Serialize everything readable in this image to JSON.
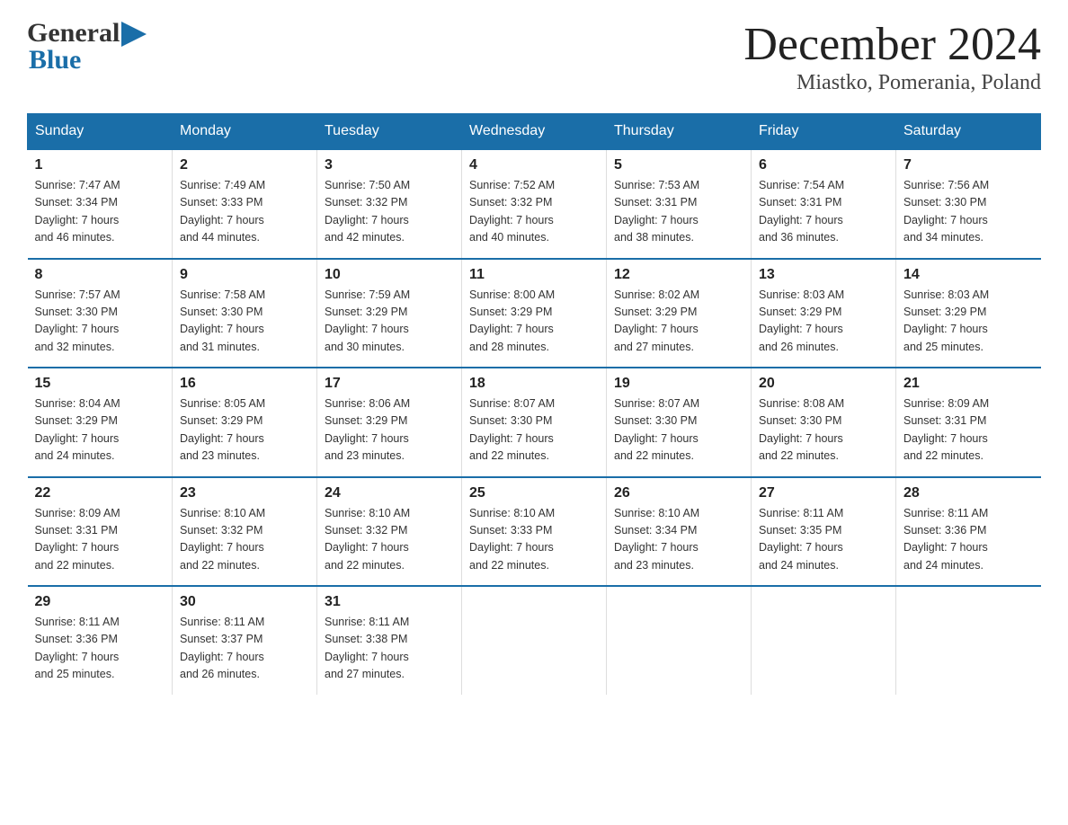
{
  "header": {
    "logo_general": "General",
    "logo_blue": "Blue",
    "month_title": "December 2024",
    "location": "Miastko, Pomerania, Poland"
  },
  "weekdays": [
    "Sunday",
    "Monday",
    "Tuesday",
    "Wednesday",
    "Thursday",
    "Friday",
    "Saturday"
  ],
  "weeks": [
    [
      {
        "day": "1",
        "info": "Sunrise: 7:47 AM\nSunset: 3:34 PM\nDaylight: 7 hours\nand 46 minutes."
      },
      {
        "day": "2",
        "info": "Sunrise: 7:49 AM\nSunset: 3:33 PM\nDaylight: 7 hours\nand 44 minutes."
      },
      {
        "day": "3",
        "info": "Sunrise: 7:50 AM\nSunset: 3:32 PM\nDaylight: 7 hours\nand 42 minutes."
      },
      {
        "day": "4",
        "info": "Sunrise: 7:52 AM\nSunset: 3:32 PM\nDaylight: 7 hours\nand 40 minutes."
      },
      {
        "day": "5",
        "info": "Sunrise: 7:53 AM\nSunset: 3:31 PM\nDaylight: 7 hours\nand 38 minutes."
      },
      {
        "day": "6",
        "info": "Sunrise: 7:54 AM\nSunset: 3:31 PM\nDaylight: 7 hours\nand 36 minutes."
      },
      {
        "day": "7",
        "info": "Sunrise: 7:56 AM\nSunset: 3:30 PM\nDaylight: 7 hours\nand 34 minutes."
      }
    ],
    [
      {
        "day": "8",
        "info": "Sunrise: 7:57 AM\nSunset: 3:30 PM\nDaylight: 7 hours\nand 32 minutes."
      },
      {
        "day": "9",
        "info": "Sunrise: 7:58 AM\nSunset: 3:30 PM\nDaylight: 7 hours\nand 31 minutes."
      },
      {
        "day": "10",
        "info": "Sunrise: 7:59 AM\nSunset: 3:29 PM\nDaylight: 7 hours\nand 30 minutes."
      },
      {
        "day": "11",
        "info": "Sunrise: 8:00 AM\nSunset: 3:29 PM\nDaylight: 7 hours\nand 28 minutes."
      },
      {
        "day": "12",
        "info": "Sunrise: 8:02 AM\nSunset: 3:29 PM\nDaylight: 7 hours\nand 27 minutes."
      },
      {
        "day": "13",
        "info": "Sunrise: 8:03 AM\nSunset: 3:29 PM\nDaylight: 7 hours\nand 26 minutes."
      },
      {
        "day": "14",
        "info": "Sunrise: 8:03 AM\nSunset: 3:29 PM\nDaylight: 7 hours\nand 25 minutes."
      }
    ],
    [
      {
        "day": "15",
        "info": "Sunrise: 8:04 AM\nSunset: 3:29 PM\nDaylight: 7 hours\nand 24 minutes."
      },
      {
        "day": "16",
        "info": "Sunrise: 8:05 AM\nSunset: 3:29 PM\nDaylight: 7 hours\nand 23 minutes."
      },
      {
        "day": "17",
        "info": "Sunrise: 8:06 AM\nSunset: 3:29 PM\nDaylight: 7 hours\nand 23 minutes."
      },
      {
        "day": "18",
        "info": "Sunrise: 8:07 AM\nSunset: 3:30 PM\nDaylight: 7 hours\nand 22 minutes."
      },
      {
        "day": "19",
        "info": "Sunrise: 8:07 AM\nSunset: 3:30 PM\nDaylight: 7 hours\nand 22 minutes."
      },
      {
        "day": "20",
        "info": "Sunrise: 8:08 AM\nSunset: 3:30 PM\nDaylight: 7 hours\nand 22 minutes."
      },
      {
        "day": "21",
        "info": "Sunrise: 8:09 AM\nSunset: 3:31 PM\nDaylight: 7 hours\nand 22 minutes."
      }
    ],
    [
      {
        "day": "22",
        "info": "Sunrise: 8:09 AM\nSunset: 3:31 PM\nDaylight: 7 hours\nand 22 minutes."
      },
      {
        "day": "23",
        "info": "Sunrise: 8:10 AM\nSunset: 3:32 PM\nDaylight: 7 hours\nand 22 minutes."
      },
      {
        "day": "24",
        "info": "Sunrise: 8:10 AM\nSunset: 3:32 PM\nDaylight: 7 hours\nand 22 minutes."
      },
      {
        "day": "25",
        "info": "Sunrise: 8:10 AM\nSunset: 3:33 PM\nDaylight: 7 hours\nand 22 minutes."
      },
      {
        "day": "26",
        "info": "Sunrise: 8:10 AM\nSunset: 3:34 PM\nDaylight: 7 hours\nand 23 minutes."
      },
      {
        "day": "27",
        "info": "Sunrise: 8:11 AM\nSunset: 3:35 PM\nDaylight: 7 hours\nand 24 minutes."
      },
      {
        "day": "28",
        "info": "Sunrise: 8:11 AM\nSunset: 3:36 PM\nDaylight: 7 hours\nand 24 minutes."
      }
    ],
    [
      {
        "day": "29",
        "info": "Sunrise: 8:11 AM\nSunset: 3:36 PM\nDaylight: 7 hours\nand 25 minutes."
      },
      {
        "day": "30",
        "info": "Sunrise: 8:11 AM\nSunset: 3:37 PM\nDaylight: 7 hours\nand 26 minutes."
      },
      {
        "day": "31",
        "info": "Sunrise: 8:11 AM\nSunset: 3:38 PM\nDaylight: 7 hours\nand 27 minutes."
      },
      {
        "day": "",
        "info": ""
      },
      {
        "day": "",
        "info": ""
      },
      {
        "day": "",
        "info": ""
      },
      {
        "day": "",
        "info": ""
      }
    ]
  ]
}
